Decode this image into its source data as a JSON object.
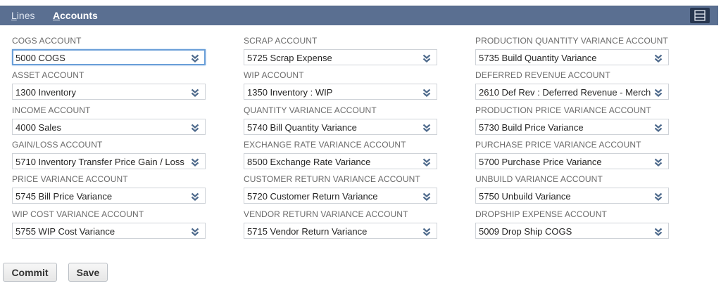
{
  "tabs": {
    "lines_first": "L",
    "lines_rest": "ines",
    "accounts_first": "A",
    "accounts_rest": "ccounts"
  },
  "toolbar": {
    "layout_icon": "layout-toggle-icon"
  },
  "fields": [
    {
      "label": "COGS ACCOUNT",
      "value": "5000 COGS"
    },
    {
      "label": "SCRAP ACCOUNT",
      "value": "5725 Scrap Expense"
    },
    {
      "label": "PRODUCTION QUANTITY VARIANCE ACCOUNT",
      "value": "5735 Build Quantity Variance"
    },
    {
      "label": "ASSET ACCOUNT",
      "value": "1300 Inventory"
    },
    {
      "label": "WIP ACCOUNT",
      "value": "1350 Inventory : WIP"
    },
    {
      "label": "DEFERRED REVENUE ACCOUNT",
      "value": "2610 Def Rev : Deferred Revenue - Merch"
    },
    {
      "label": "INCOME ACCOUNT",
      "value": "4000 Sales"
    },
    {
      "label": "QUANTITY VARIANCE ACCOUNT",
      "value": "5740 Bill Quantity Variance"
    },
    {
      "label": "PRODUCTION PRICE VARIANCE ACCOUNT",
      "value": "5730 Build Price Variance"
    },
    {
      "label": "GAIN/LOSS ACCOUNT",
      "value": "5710 Inventory Transfer Price Gain / Loss"
    },
    {
      "label": "EXCHANGE RATE VARIANCE ACCOUNT",
      "value": "8500 Exchange Rate Variance"
    },
    {
      "label": "PURCHASE PRICE VARIANCE ACCOUNT",
      "value": "5700 Purchase Price Variance"
    },
    {
      "label": "PRICE VARIANCE ACCOUNT",
      "value": "5745 Bill Price Variance"
    },
    {
      "label": "CUSTOMER RETURN VARIANCE ACCOUNT",
      "value": "5720 Customer Return Variance"
    },
    {
      "label": "UNBUILD VARIANCE ACCOUNT",
      "value": "5750 Unbuild Variance"
    },
    {
      "label": "WIP COST VARIANCE ACCOUNT",
      "value": "5755 WIP Cost Variance"
    },
    {
      "label": "VENDOR RETURN VARIANCE ACCOUNT",
      "value": "5715 Vendor Return Variance"
    },
    {
      "label": "DROPSHIP EXPENSE ACCOUNT",
      "value": "5009 Drop Ship COGS"
    }
  ],
  "buttons": {
    "commit": "Commit",
    "save": "Save"
  },
  "colors": {
    "tabbar": "#5a6f91",
    "focus": "#6a9fd8",
    "arrow": "#4e6a8c"
  }
}
